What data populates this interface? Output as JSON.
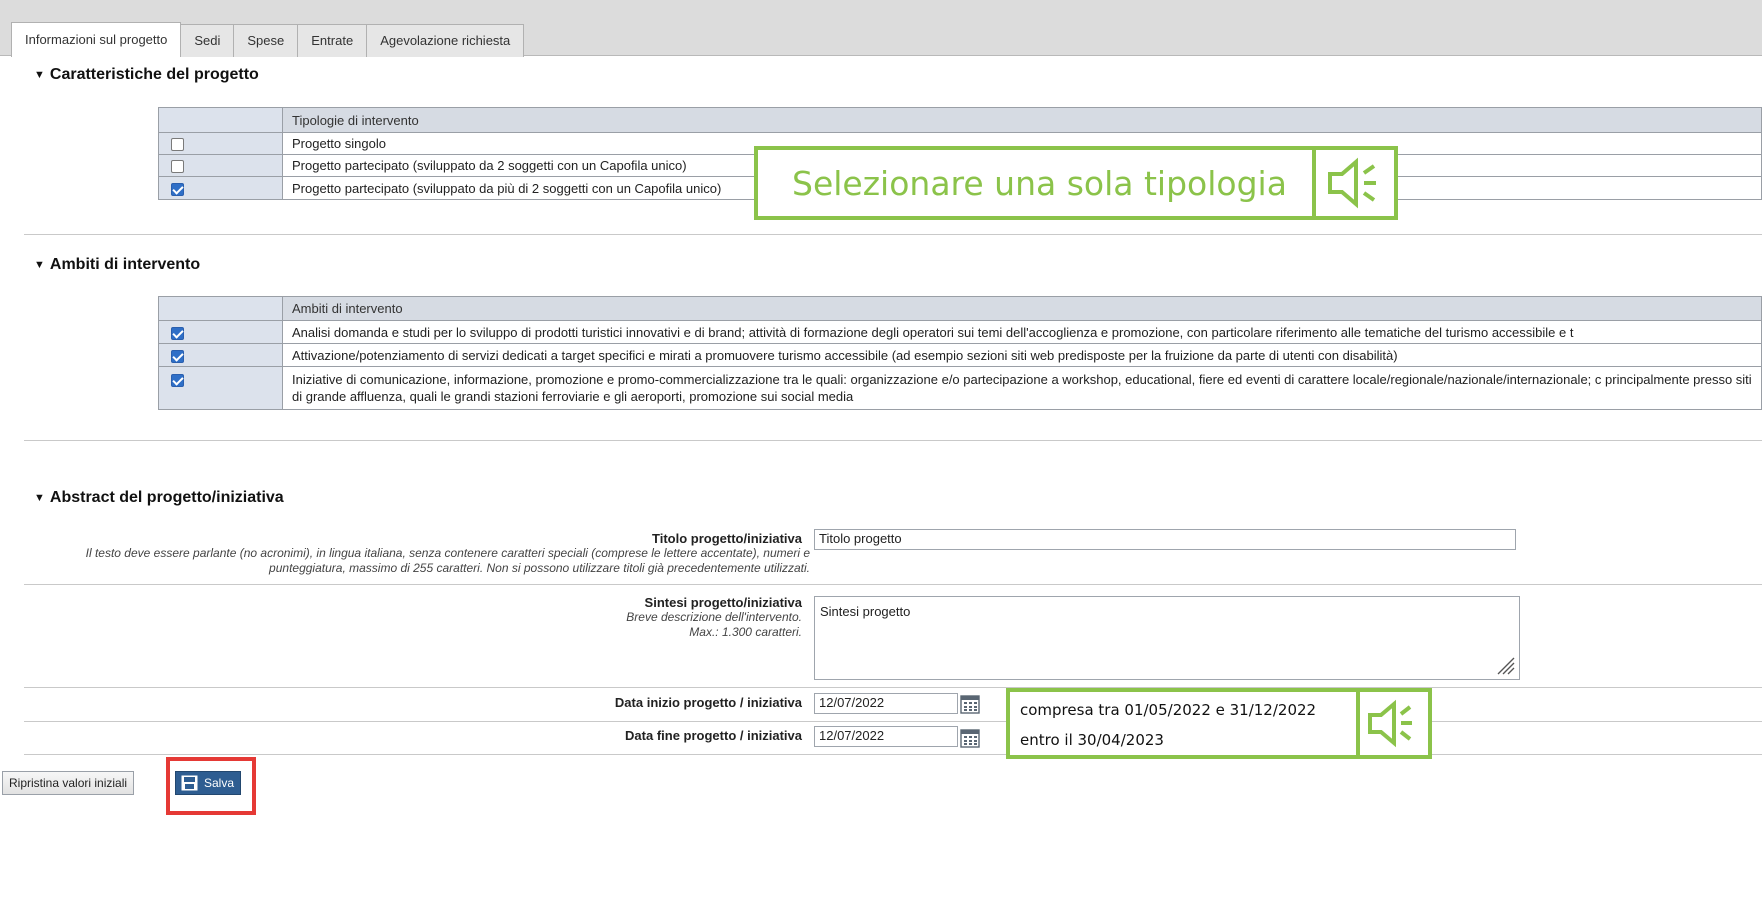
{
  "tabs": [
    "Informazioni sul progetto",
    "Sedi",
    "Spese",
    "Entrate",
    "Agevolazione richiesta"
  ],
  "caratteristiche": {
    "title": "Caratteristiche del progetto",
    "header": "Tipologie di intervento",
    "rows": [
      {
        "label": "Progetto singolo",
        "checked": false
      },
      {
        "label": "Progetto partecipato (sviluppato da 2 soggetti con un Capofila unico)",
        "checked": false
      },
      {
        "label": "Progetto partecipato (sviluppato da più di 2 soggetti con un Capofila unico)",
        "checked": true
      }
    ],
    "callout": "Selezionare una sola tipologia"
  },
  "ambiti": {
    "title": "Ambiti di intervento",
    "header": "Ambiti di intervento",
    "rows": [
      {
        "label": "Analisi domanda e studi per lo sviluppo di prodotti turistici innovativi e di brand; attività di formazione degli operatori sui temi dell'accoglienza e promozione, con particolare riferimento alle tematiche del turismo accessibile e t",
        "checked": true
      },
      {
        "label": "Attivazione/potenziamento di servizi dedicati a target specifici e mirati a promuovere turismo accessibile (ad esempio sezioni siti web predisposte per la fruizione da parte di utenti con disabilità)",
        "checked": true
      },
      {
        "label": "Iniziative di comunicazione, informazione, promozione e promo-commercializzazione tra le quali: organizzazione e/o partecipazione a workshop, educational, fiere ed eventi di carattere locale/regionale/nazionale/internazionale; c principalmente presso siti di grande affluenza, quali le grandi stazioni ferroviarie e gli aeroporti, promozione sui social media",
        "checked": true
      }
    ]
  },
  "abstract": {
    "title": "Abstract del progetto/iniziativa",
    "titolo_label": "Titolo progetto/iniziativa",
    "titolo_help": "Il testo deve essere parlante (no acronimi), in lingua italiana, senza contenere caratteri speciali (comprese le lettere accentate), numeri e punteggiatura, massimo di 255 caratteri. Non si possono utilizzare titoli già precedentemente utilizzati.",
    "titolo_value": "Titolo progetto",
    "sintesi_label": "Sintesi progetto/iniziativa",
    "sintesi_help1": "Breve descrizione dell'intervento.",
    "sintesi_help2": "Max.: 1.300 caratteri.",
    "sintesi_value": "Sintesi progetto",
    "data_inizio_label": "Data inizio progetto / iniziativa",
    "data_inizio_value": "12/07/2022",
    "data_fine_label": "Data fine progetto / iniziativa",
    "data_fine_value": "12/07/2022",
    "callout_line1": "compresa tra 01/05/2022 e 31/12/2022",
    "callout_line2": "entro il 30/04/2023"
  },
  "buttons": {
    "reset": "Ripristina valori iniziali",
    "save": "Salva"
  },
  "colors": {
    "callout_green": "#8bc34a",
    "highlight_red": "#e53935",
    "save_blue": "#2e5d91"
  },
  "icons": [
    "speaker-icon",
    "calendar-icon",
    "save-icon",
    "resize-grip-icon"
  ]
}
